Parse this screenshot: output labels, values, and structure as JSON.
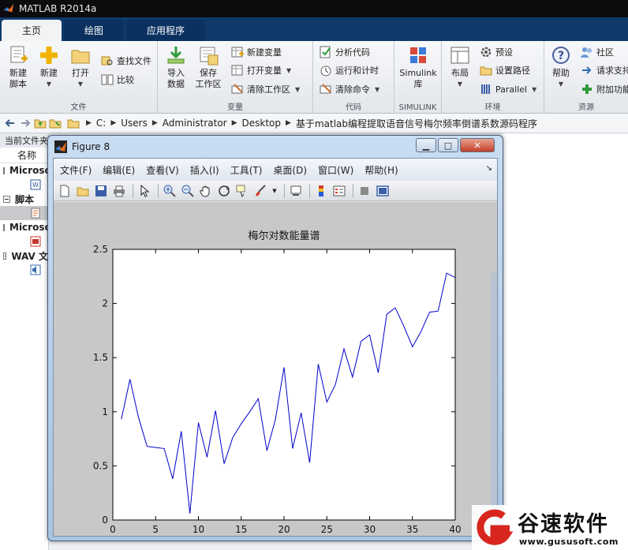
{
  "window": {
    "title": "MATLAB R2014a"
  },
  "main_tabs": [
    {
      "label": "主页",
      "active": true
    },
    {
      "label": "绘图",
      "active": false
    },
    {
      "label": "应用程序",
      "active": false
    }
  ],
  "ribbon": {
    "file": {
      "label": "文件",
      "new_script": "新建\n脚本",
      "new": "新建",
      "open": "打开",
      "find_files": "查找文件",
      "compare": "比较"
    },
    "variable": {
      "label": "变量",
      "import": "导入\n数据",
      "save_ws": "保存\n工作区",
      "new_var": "新建变量",
      "open_var": "打开变量",
      "clear_ws": "清除工作区"
    },
    "code": {
      "label": "代码",
      "analyze": "分析代码",
      "run_time": "运行和计时",
      "clear_cmd": "清除命令"
    },
    "simulink": {
      "label": "SIMULINK",
      "lib": "Simulink\n库"
    },
    "env": {
      "label": "环境",
      "layout": "布局",
      "prefs": "预设",
      "set_path": "设置路径",
      "parallel": "Parallel"
    },
    "resources": {
      "label": "资源",
      "help": "帮助",
      "community": "社区",
      "request_support": "请求支持",
      "addons": "附加功能"
    }
  },
  "address": {
    "path": [
      "C:",
      "Users",
      "Administrator",
      "Desktop",
      "基于matlab编程提取语音信号梅尔频率倒谱系数源码程序"
    ]
  },
  "file_panel": {
    "title": "当前文件夹",
    "name_column": "名称",
    "groups": [
      "Microsoft",
      "脚本",
      "Microsoft",
      "WAV 文"
    ]
  },
  "figure": {
    "title": "Figure 8",
    "menus": [
      "文件(F)",
      "编辑(E)",
      "查看(V)",
      "插入(I)",
      "工具(T)",
      "桌面(D)",
      "窗口(W)",
      "帮助(H)"
    ]
  },
  "chart_data": {
    "type": "line",
    "title": "梅尔对数能量谱",
    "xlim": [
      0,
      40
    ],
    "ylim": [
      0,
      2.5
    ],
    "xticks": [
      0,
      5,
      10,
      15,
      20,
      25,
      30,
      35,
      40
    ],
    "yticks": [
      0,
      0.5,
      1,
      1.5,
      2,
      2.5
    ],
    "x": [
      1,
      2,
      3,
      4,
      5,
      6,
      7,
      8,
      9,
      10,
      11,
      12,
      13,
      14,
      15,
      16,
      17,
      18,
      19,
      20,
      21,
      22,
      23,
      24,
      25,
      26,
      27,
      28,
      29,
      30,
      31,
      32,
      33,
      34,
      35,
      36,
      37,
      38,
      39,
      40
    ],
    "series": [
      {
        "color": "#0000cc",
        "values": [
          0.93,
          1.3,
          0.95,
          0.68,
          0.67,
          0.66,
          0.38,
          0.82,
          0.06,
          0.9,
          0.58,
          1.01,
          0.52,
          0.76,
          0.89,
          1.0,
          1.12,
          0.64,
          0.93,
          1.41,
          0.66,
          0.99,
          0.53,
          1.44,
          1.09,
          1.25,
          1.58,
          1.32,
          1.65,
          1.71,
          1.36,
          1.9,
          1.96,
          1.79,
          1.6,
          1.74,
          1.92,
          1.93,
          2.28,
          2.24
        ]
      }
    ],
    "grid": false
  },
  "watermark": {
    "text": "谷速软件",
    "url": "www.gususoft.com"
  }
}
